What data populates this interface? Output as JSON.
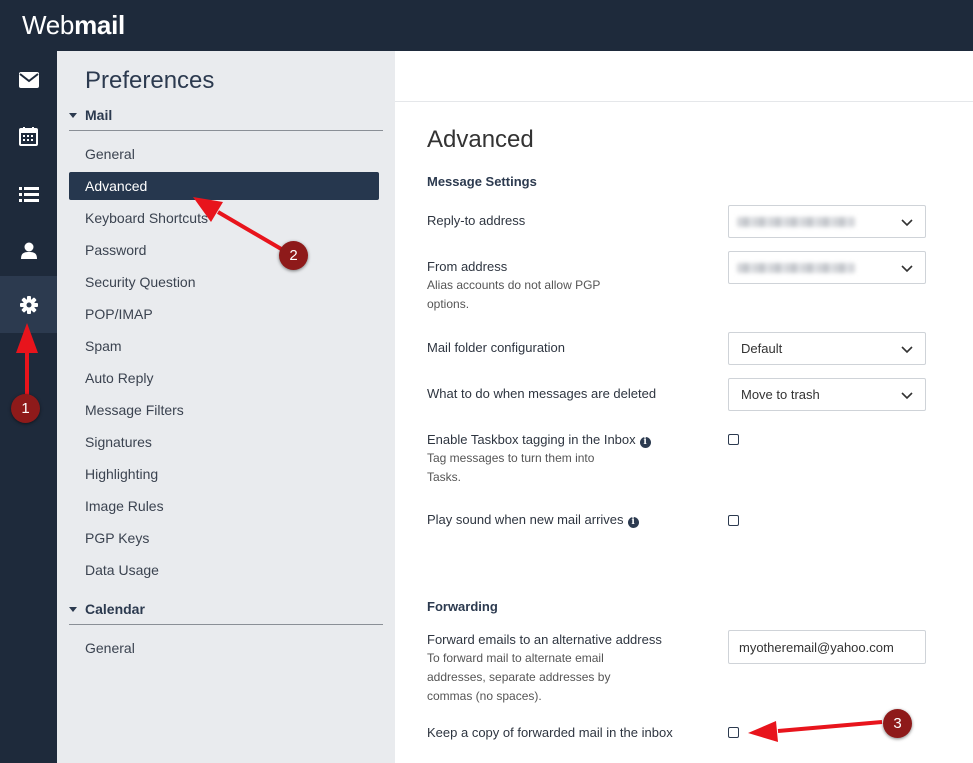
{
  "app": {
    "logo_light": "Web",
    "logo_bold": "mail"
  },
  "iconbar": [
    {
      "name": "mail-icon"
    },
    {
      "name": "calendar-icon"
    },
    {
      "name": "tasks-list-icon"
    },
    {
      "name": "contacts-icon"
    },
    {
      "name": "settings-gear-icon",
      "active": true
    }
  ],
  "preferences": {
    "title": "Preferences",
    "sections": [
      {
        "label": "Mail",
        "items": [
          "General",
          "Advanced",
          "Keyboard Shortcuts",
          "Password",
          "Security Question",
          "POP/IMAP",
          "Spam",
          "Auto Reply",
          "Message Filters",
          "Signatures",
          "Highlighting",
          "Image Rules",
          "PGP Keys",
          "Data Usage"
        ],
        "active": "Advanced"
      },
      {
        "label": "Calendar",
        "items": [
          "General"
        ]
      }
    ]
  },
  "main": {
    "title": "Advanced",
    "message_settings": {
      "heading": "Message Settings",
      "reply_to": {
        "label": "Reply-to address"
      },
      "from": {
        "label": "From address",
        "hint": "Alias accounts do not allow PGP options."
      },
      "folder_config": {
        "label": "Mail folder configuration",
        "value": "Default"
      },
      "deleted": {
        "label": "What to do when messages are deleted",
        "value": "Move to trash"
      },
      "taskbox": {
        "label": "Enable Taskbox tagging in the Inbox",
        "hint": "Tag messages to turn them into Tasks.",
        "checked": false
      },
      "sound": {
        "label": "Play sound when new mail arrives",
        "checked": false
      }
    },
    "forwarding": {
      "heading": "Forwarding",
      "forward": {
        "label": "Forward emails to an alternative address",
        "hint": "To forward mail to alternate email addresses, separate addresses by commas (no spaces).",
        "value": "myotheremail@yahoo.com"
      },
      "keep_copy": {
        "label": "Keep a copy of forwarded mail in the inbox",
        "checked": false
      }
    }
  },
  "annotations": {
    "badges": [
      "1",
      "2",
      "3"
    ],
    "arrow_color": "#e8141c",
    "badge_color": "#8e1a1a"
  }
}
